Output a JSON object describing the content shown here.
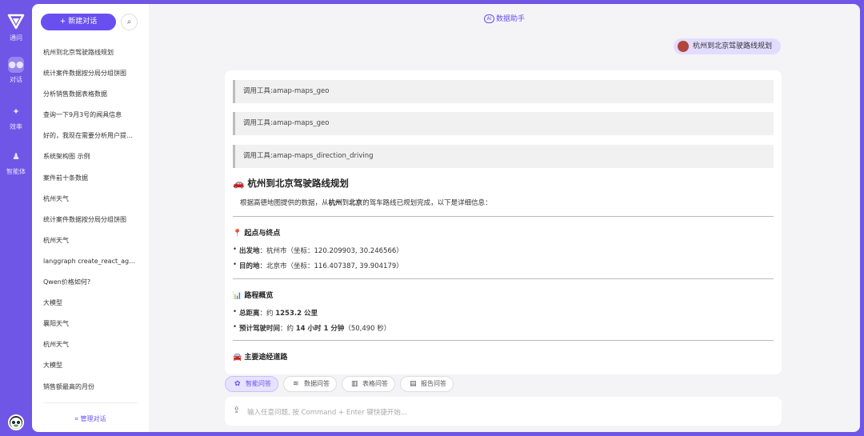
{
  "rail": {
    "items": [
      {
        "label": "通问",
        "icon": "logo-icon"
      },
      {
        "label": "对话",
        "icon": "chat-bubble-icon"
      },
      {
        "label": "效率",
        "icon": "bulb-icon"
      },
      {
        "label": "智能体",
        "icon": "agent-icon"
      }
    ]
  },
  "sidebar": {
    "new_chat_label": "+ 新建对话",
    "search_icon": "search-icon",
    "history": [
      "杭州到北京驾驶路线规划",
      "统计案件数据按分局分组饼图",
      "分析销售数据表格数据",
      "查询一下9月3号的闻具信息",
      "好的，我现在需要分析用户提供...",
      "系统架构图 示例",
      "案件前十条数据",
      "杭州天气",
      "统计案件数据按分局分组饼图",
      "杭州天气",
      "langgraph create_react_agent...",
      "Qwen价格如何?",
      "大模型",
      "襄阳天气",
      "杭州天气",
      "大模型",
      "销售额最高的月份"
    ],
    "manage_label": "管理对话"
  },
  "main": {
    "title": "数据助手",
    "ai_badge": "AI",
    "user_message": "杭州到北京驾驶路线规划",
    "tools": [
      "调用工具:amap-maps_geo",
      "调用工具:amap-maps_geo",
      "调用工具:amap-maps_direction_driving"
    ],
    "heading": "🚗 杭州到北京驾驶路线规划",
    "intro_a": "根据高德地图提供的数据，从",
    "intro_b": "杭州",
    "intro_c": "到",
    "intro_d": "北京",
    "intro_e": "的驾车路线已规划完成，以下是详细信息：",
    "sec1_title": "📍 起点与终点",
    "sec1_items": [
      {
        "label": "出发地",
        "value": "：杭州市（坐标：120.209903, 30.246566）"
      },
      {
        "label": "目的地",
        "value": "：北京市（坐标：116.407387, 39.904179）"
      }
    ],
    "sec2_title": "📊 路程概览",
    "sec2_item1_label": "总距离",
    "sec2_item1_pre": "：约 ",
    "sec2_item1_val": "1253.2 公里",
    "sec2_item2_label": "预计驾驶时间",
    "sec2_item2_pre": "：约 ",
    "sec2_item2_val": "14 小时 1 分钟",
    "sec2_item2_post": "（50,490 秒）",
    "sec3_title": "🚘 主要途经道路"
  },
  "modes": [
    {
      "label": "智能问答",
      "icon": "smart-qa-icon"
    },
    {
      "label": "数据问答",
      "icon": "database-icon"
    },
    {
      "label": "表格问答",
      "icon": "bar-chart-icon"
    },
    {
      "label": "报告问答",
      "icon": "report-icon"
    }
  ],
  "input": {
    "placeholder": "输入任意问题, 按 Command + Enter 键快捷开始..."
  },
  "colors": {
    "accent": "#6a4ff0",
    "frame": "#6f56e6"
  }
}
